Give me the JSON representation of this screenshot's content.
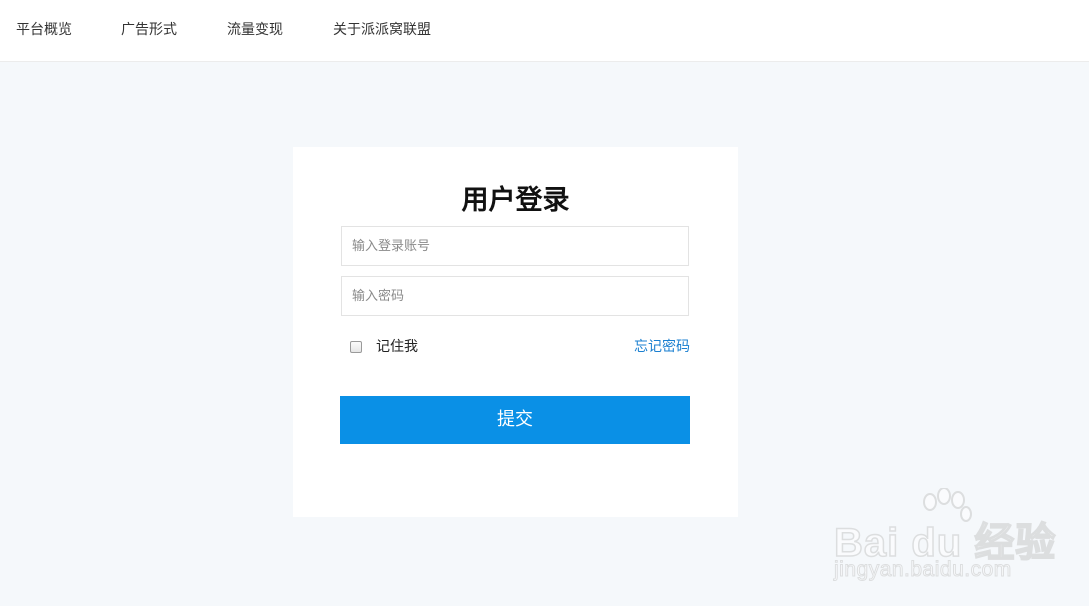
{
  "nav": {
    "items": [
      {
        "label": "平台概览"
      },
      {
        "label": "广告形式"
      },
      {
        "label": "流量变现"
      },
      {
        "label": "关于派派窝联盟"
      }
    ]
  },
  "login": {
    "title": "用户登录",
    "account_placeholder": "输入登录账号",
    "account_value": "",
    "password_placeholder": "输入密码",
    "password_value": "",
    "remember_label": "记住我",
    "remember_checked": false,
    "forgot_label": "忘记密码",
    "submit_label": "提交"
  },
  "watermark": {
    "logo_text": "Bai du 经验",
    "url_text": "jingyan.baidu.com"
  },
  "colors": {
    "background": "#f5f8fb",
    "accent": "#0a90e6",
    "link": "#1a7fd0"
  }
}
